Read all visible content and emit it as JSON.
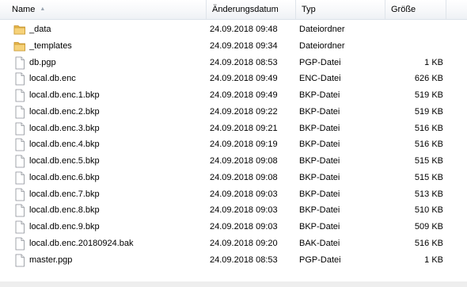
{
  "columns": {
    "name": "Name",
    "date": "Änderungsdatum",
    "type": "Typ",
    "size": "Größe"
  },
  "files": [
    {
      "icon": "folder-icon",
      "name": "_data",
      "date": "24.09.2018 09:48",
      "type": "Dateiordner",
      "size": ""
    },
    {
      "icon": "folder-icon",
      "name": "_templates",
      "date": "24.09.2018 09:34",
      "type": "Dateiordner",
      "size": ""
    },
    {
      "icon": "file-icon",
      "name": "db.pgp",
      "date": "24.09.2018 08:53",
      "type": "PGP-Datei",
      "size": "1 KB"
    },
    {
      "icon": "file-icon",
      "name": "local.db.enc",
      "date": "24.09.2018 09:49",
      "type": "ENC-Datei",
      "size": "626 KB"
    },
    {
      "icon": "file-icon",
      "name": "local.db.enc.1.bkp",
      "date": "24.09.2018 09:49",
      "type": "BKP-Datei",
      "size": "519 KB"
    },
    {
      "icon": "file-icon",
      "name": "local.db.enc.2.bkp",
      "date": "24.09.2018 09:22",
      "type": "BKP-Datei",
      "size": "519 KB"
    },
    {
      "icon": "file-icon",
      "name": "local.db.enc.3.bkp",
      "date": "24.09.2018 09:21",
      "type": "BKP-Datei",
      "size": "516 KB"
    },
    {
      "icon": "file-icon",
      "name": "local.db.enc.4.bkp",
      "date": "24.09.2018 09:19",
      "type": "BKP-Datei",
      "size": "516 KB"
    },
    {
      "icon": "file-icon",
      "name": "local.db.enc.5.bkp",
      "date": "24.09.2018 09:08",
      "type": "BKP-Datei",
      "size": "515 KB"
    },
    {
      "icon": "file-icon",
      "name": "local.db.enc.6.bkp",
      "date": "24.09.2018 09:08",
      "type": "BKP-Datei",
      "size": "515 KB"
    },
    {
      "icon": "file-icon",
      "name": "local.db.enc.7.bkp",
      "date": "24.09.2018 09:03",
      "type": "BKP-Datei",
      "size": "513 KB"
    },
    {
      "icon": "file-icon",
      "name": "local.db.enc.8.bkp",
      "date": "24.09.2018 09:03",
      "type": "BKP-Datei",
      "size": "510 KB"
    },
    {
      "icon": "file-icon",
      "name": "local.db.enc.9.bkp",
      "date": "24.09.2018 09:03",
      "type": "BKP-Datei",
      "size": "509 KB"
    },
    {
      "icon": "file-icon",
      "name": "local.db.enc.20180924.bak",
      "date": "24.09.2018 09:20",
      "type": "BAK-Datei",
      "size": "516 KB"
    },
    {
      "icon": "file-icon",
      "name": "master.pgp",
      "date": "24.09.2018 08:53",
      "type": "PGP-Datei",
      "size": "1 KB"
    }
  ]
}
